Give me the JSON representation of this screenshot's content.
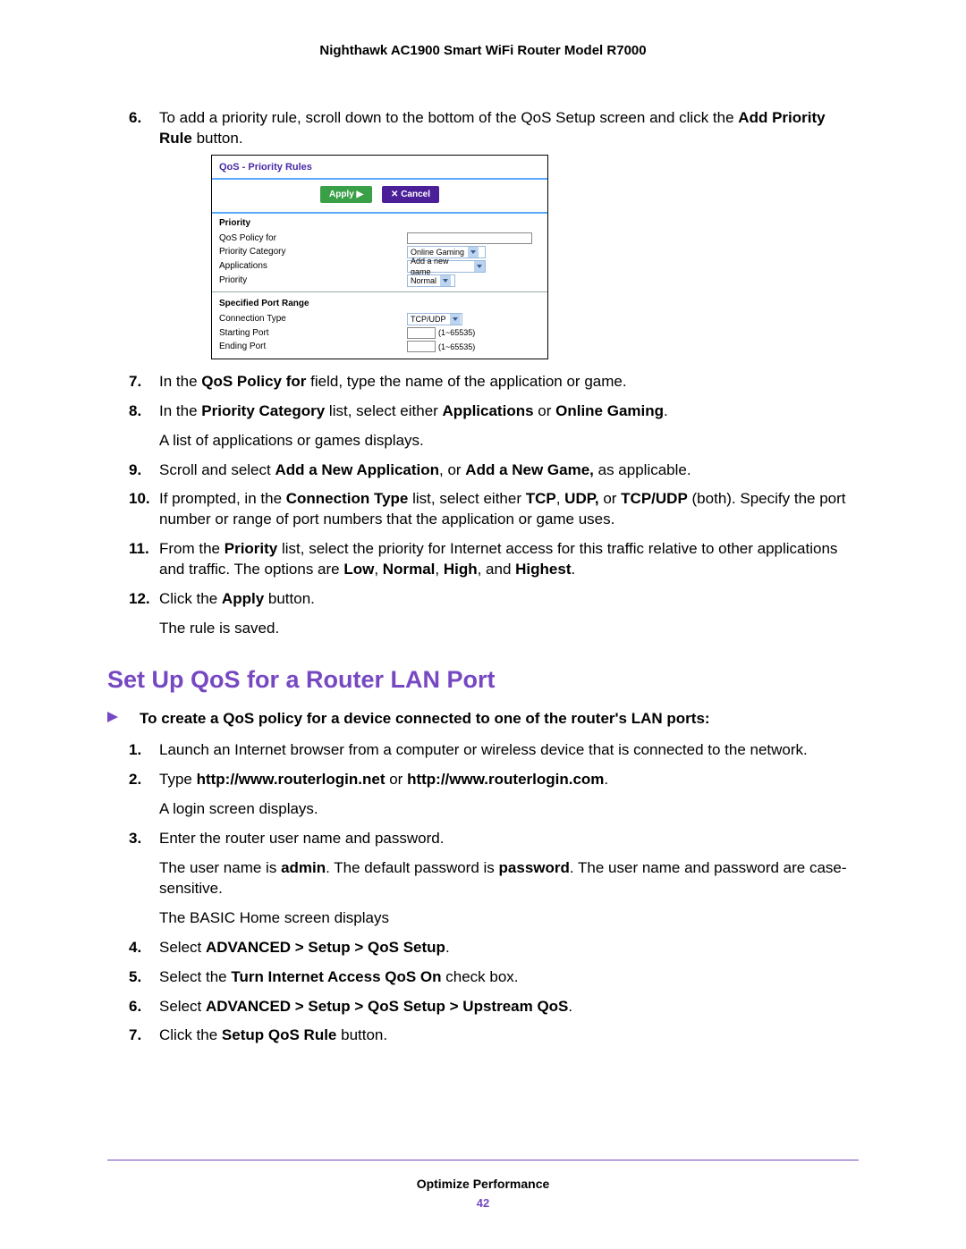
{
  "header_title": "Nighthawk AC1900 Smart WiFi Router Model R7000",
  "section_heading": "Set Up QoS for a Router LAN Port",
  "lead_line": "To create a QoS policy for a device connected to one of the router's LAN ports:",
  "steps_a": {
    "s6": {
      "num": "6.",
      "pre": "To add a priority rule, scroll down to the bottom of the QoS Setup screen and click the ",
      "bold1": "Add Priority Rule",
      "post": " button."
    },
    "s7": {
      "num": "7.",
      "pre": "In the ",
      "bold1": "QoS Policy for",
      "post": " field, type the name of the application or game."
    },
    "s8": {
      "num": "8.",
      "pre": "In the ",
      "bold1": "Priority Category",
      "mid1": " list, select either ",
      "bold2": "Applications",
      "mid2": " or ",
      "bold3": "Online Gaming",
      "post": ".",
      "sub": "A list of applications or games displays."
    },
    "s9": {
      "num": "9.",
      "pre": "Scroll and select ",
      "bold1": "Add a New Application",
      "mid1": ", or ",
      "bold2": "Add a New Game,",
      "post": " as applicable."
    },
    "s10": {
      "num": "10.",
      "pre": "If prompted, in the ",
      "bold1": "Connection Type",
      "mid1": " list, select either ",
      "bold2": "TCP",
      "mid2": ", ",
      "bold3": "UDP,",
      "mid3": " or ",
      "bold4": "TCP/UDP",
      "post": " (both). Specify the port number or range of port numbers that the application or game uses."
    },
    "s11": {
      "num": "11.",
      "pre": "From the ",
      "bold1": "Priority",
      "mid1": " list, select the priority for Internet access for this traffic relative to other applications and traffic. The options are ",
      "bold2": "Low",
      "mid2": ", ",
      "bold3": "Normal",
      "mid3": ", ",
      "bold4": "High",
      "mid4": ", and ",
      "bold5": "Highest",
      "post": "."
    },
    "s12": {
      "num": "12.",
      "pre": "Click the ",
      "bold1": "Apply",
      "post": " button.",
      "sub": "The rule is saved."
    }
  },
  "steps_b": {
    "s1": {
      "num": "1.",
      "text": "Launch an Internet browser from a computer or wireless device that is connected to the network."
    },
    "s2": {
      "num": "2.",
      "pre": "Type ",
      "bold1": "http://www.routerlogin.net",
      "mid1": " or ",
      "bold2": "http://www.routerlogin.com",
      "post": ".",
      "sub": "A login screen displays."
    },
    "s3": {
      "num": "3.",
      "text": "Enter the router user name and password.",
      "sub1_pre": "The user name is ",
      "sub1_b1": "admin",
      "sub1_mid": ". The default password is ",
      "sub1_b2": "password",
      "sub1_post": ". The user name and password are case-sensitive.",
      "sub2": "The BASIC Home screen displays"
    },
    "s4": {
      "num": "4.",
      "pre": "Select ",
      "bold1": "ADVANCED > Setup > QoS Setup",
      "post": "."
    },
    "s5": {
      "num": "5.",
      "pre": "Select the ",
      "bold1": "Turn Internet Access QoS On",
      "post": " check box."
    },
    "s6": {
      "num": "6.",
      "pre": "Select ",
      "bold1": "ADVANCED > Setup > QoS Setup > Upstream QoS",
      "post": "."
    },
    "s7": {
      "num": "7.",
      "pre": "Click the ",
      "bold1": "Setup QoS Rule",
      "post": " button."
    }
  },
  "screenshot": {
    "title": "QoS - Priority Rules",
    "apply": "Apply",
    "cancel": "Cancel",
    "cancel_x": "✕",
    "section_priority": "Priority",
    "label_policy": "QoS Policy for",
    "label_category": "Priority Category",
    "label_applications": "Applications",
    "label_priority": "Priority",
    "section_portrange": "Specified Port Range",
    "label_conn_type": "Connection Type",
    "label_start_port": "Starting Port",
    "label_end_port": "Ending Port",
    "val_category": "Online Gaming",
    "val_applications": "Add a new game",
    "val_priority": "Normal",
    "val_conn_type": "TCP/UDP",
    "port_hint": "(1~65535)",
    "arrow_glyph": "▶"
  },
  "footer_section": "Optimize Performance",
  "page_number": "42"
}
